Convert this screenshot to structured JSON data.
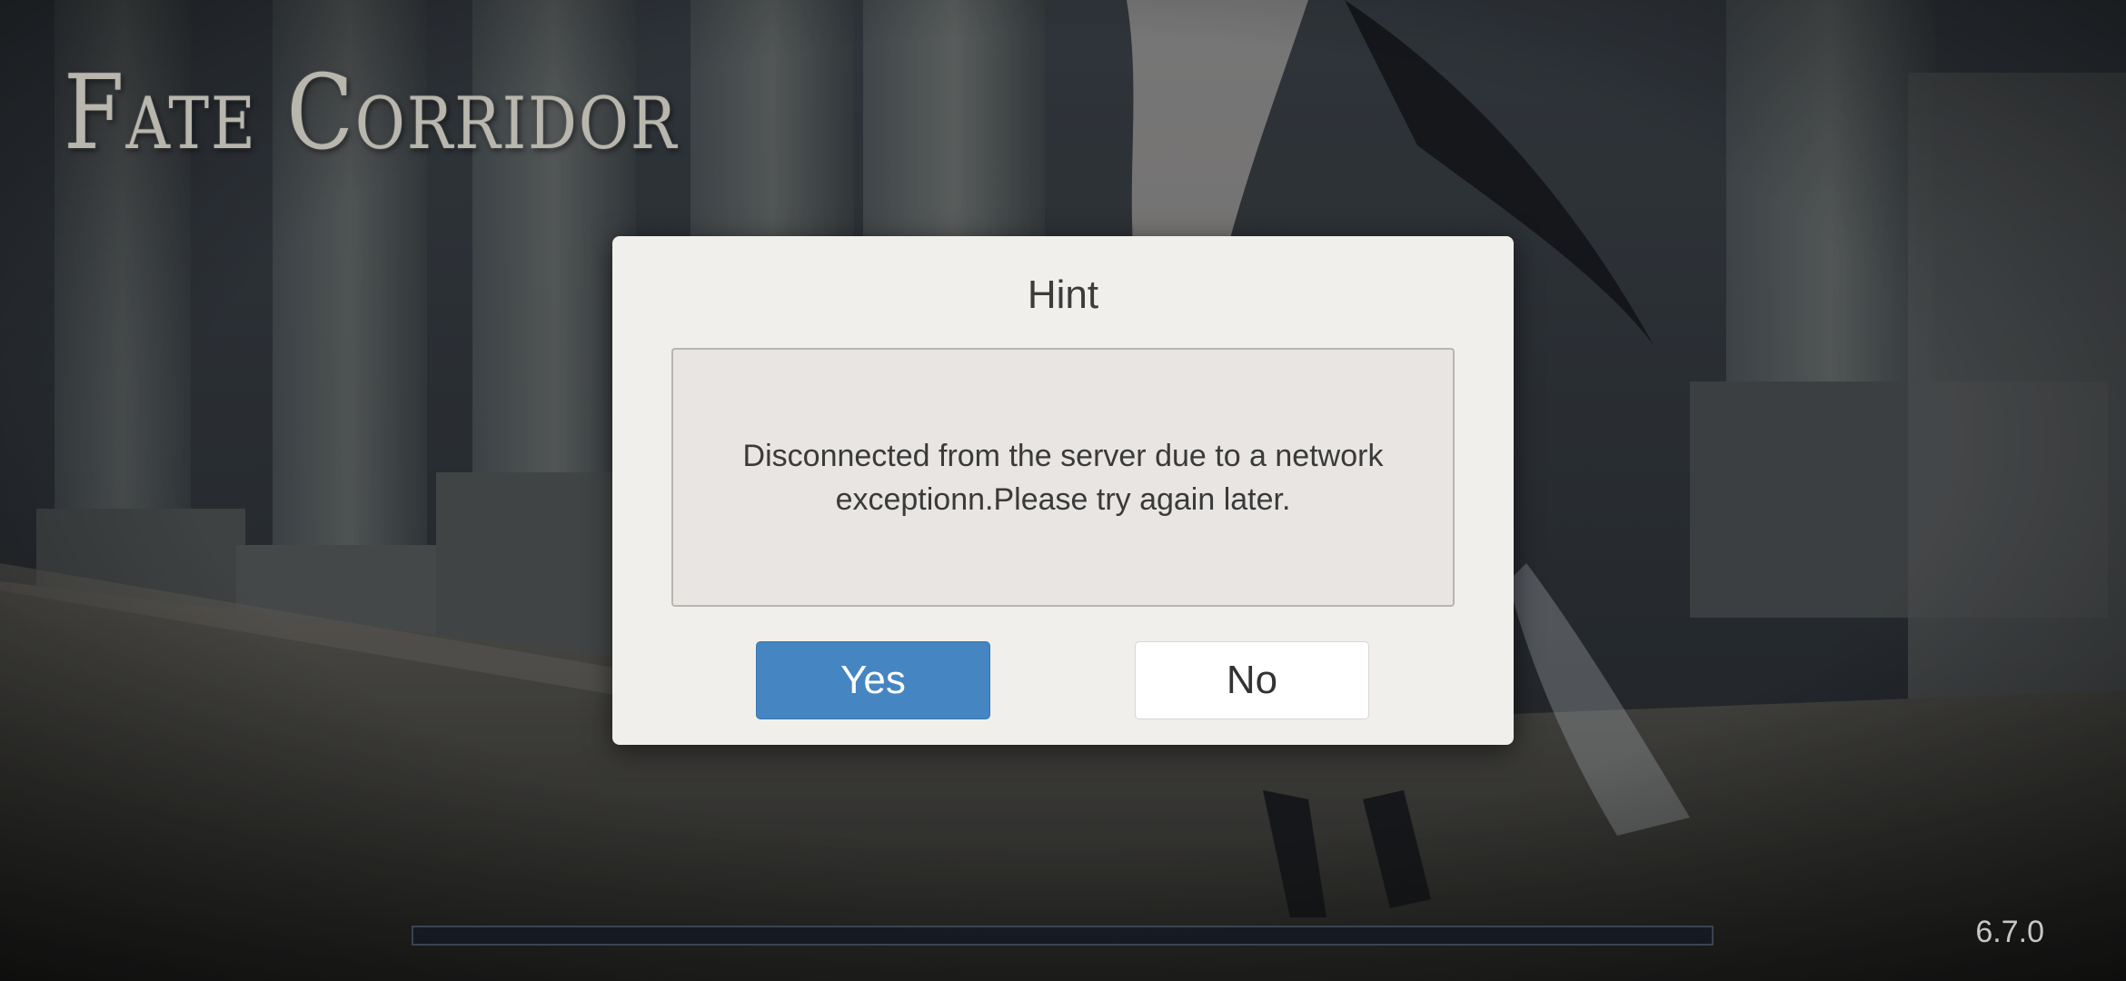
{
  "game": {
    "title": "Fate Corridor",
    "version": "6.7.0",
    "loading_progress": 0
  },
  "dialog": {
    "title": "Hint",
    "message": "Disconnected from the server due to a network exceptionn.Please try again later.",
    "yes_label": "Yes",
    "no_label": "No"
  },
  "colors": {
    "primary_button": "#4585c2",
    "dialog_background": "#f0efeb"
  }
}
